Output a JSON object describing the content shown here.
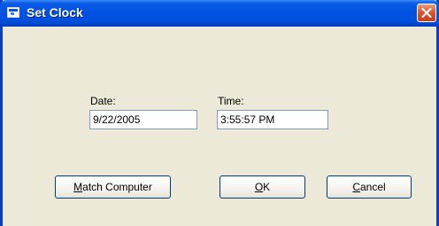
{
  "window": {
    "title": "Set Clock",
    "close_icon": "close-icon",
    "app_icon": "window-icon"
  },
  "form": {
    "date_label": "Date:",
    "date_value": "9/22/2005",
    "time_label": "Time:",
    "time_value": "3:55:57 PM"
  },
  "buttons": {
    "match_computer": {
      "accel": "M",
      "rest": "atch Computer"
    },
    "ok": {
      "accel": "O",
      "rest": "K"
    },
    "cancel": {
      "accel": "C",
      "rest": "ancel"
    }
  },
  "colors": {
    "titlebar": "#0053e1",
    "dialog_face": "#ece9d8",
    "close_button": "#d8542f",
    "field_border": "#7f9db9"
  }
}
